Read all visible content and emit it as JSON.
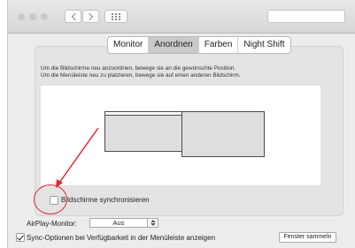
{
  "window": {
    "tabs": [
      {
        "label": "Monitor",
        "active": false
      },
      {
        "label": "Anordnen",
        "active": true
      },
      {
        "label": "Farben",
        "active": false
      },
      {
        "label": "Night Shift",
        "active": false
      }
    ]
  },
  "arrange": {
    "hint_line_1": "Um die Bildschirme neu anzuordnen, bewege sie an die gewünschte Position.",
    "hint_line_2": "Um die Menüleiste neu zu platzieren, bewege sie auf einen anderen Bildschirm.",
    "mirror_label": "Bildschirme synchronisieren",
    "mirror_checked": false
  },
  "footer": {
    "airplay_label": "AirPlay-Monitor:",
    "airplay_value": "Aus",
    "sync_label": "Sync-Optionen bei Verfügbarkeit in der Menüleiste anzeigen",
    "sync_checked": true,
    "gather_button": "Fenster sammeln"
  },
  "colors": {
    "annotation": "#e0262e",
    "active_tab": "#c9c9c9"
  }
}
